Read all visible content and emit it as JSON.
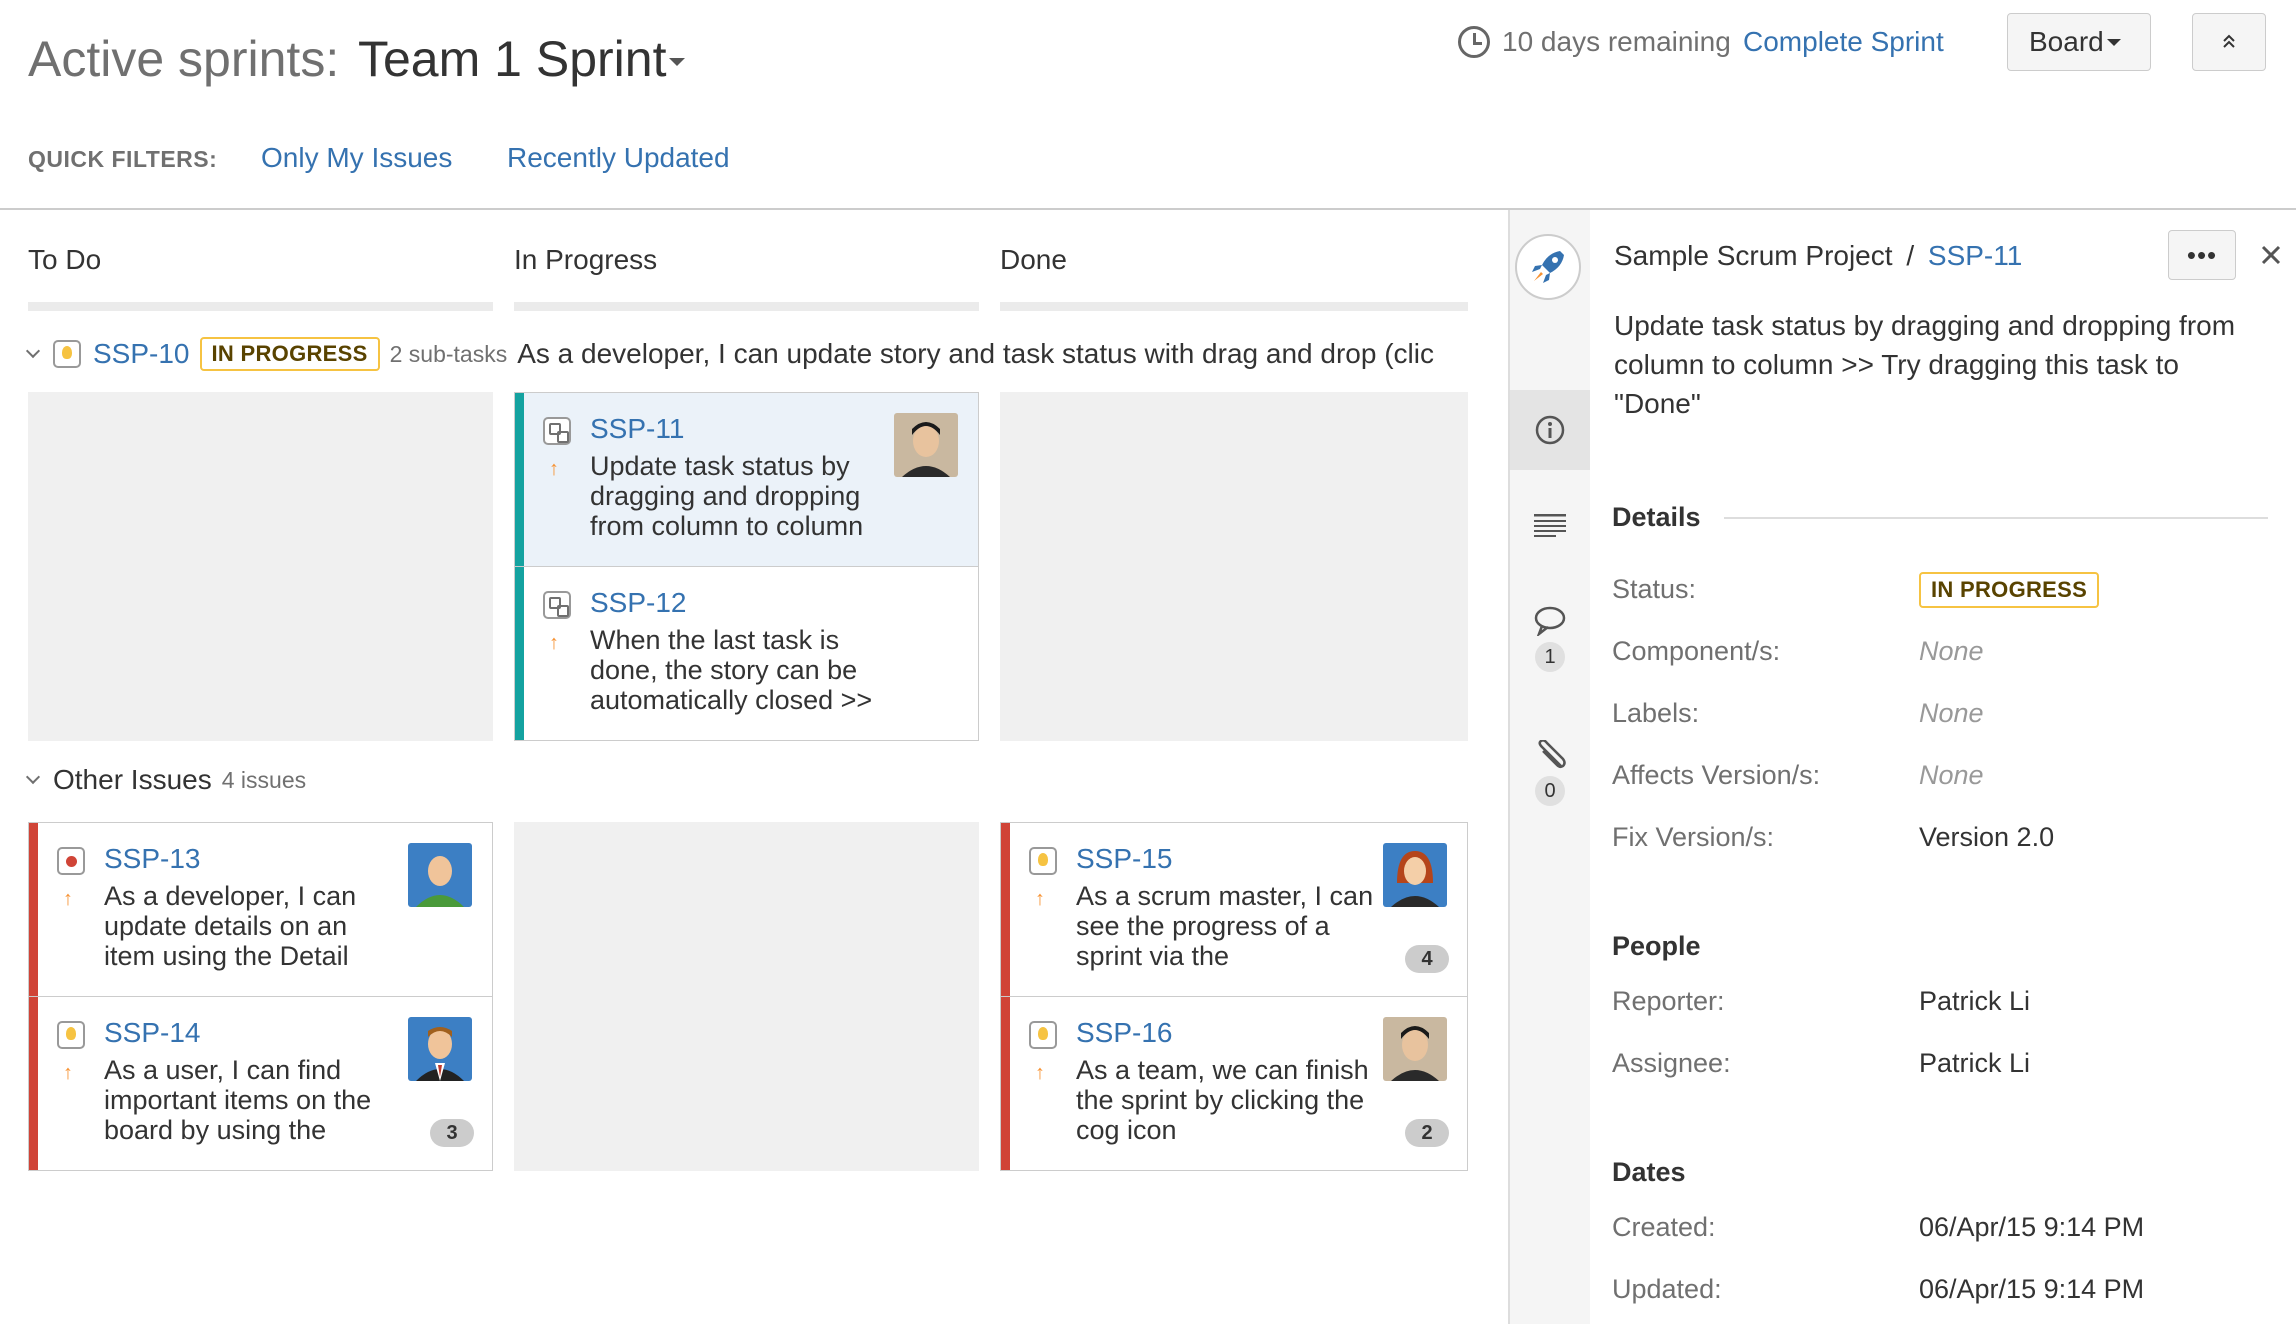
{
  "header": {
    "title": "Active sprints:",
    "sprint_name": "Team 1 Sprint",
    "days_remaining": "10 days remaining",
    "complete_sprint": "Complete Sprint",
    "board_button": "Board"
  },
  "quick_filters": {
    "label": "QUICK FILTERS:",
    "items": [
      "Only My Issues",
      "Recently Updated"
    ]
  },
  "columns": [
    "To Do",
    "In Progress",
    "Done"
  ],
  "swimlane": {
    "key": "SSP-10",
    "status": "IN PROGRESS",
    "subtasks": "2 sub-tasks",
    "summary": "As a developer, I can update story and task status with drag and drop (clic"
  },
  "cards": [
    {
      "key": "SSP-11",
      "summary": "Update task status by dragging and dropping from column to column",
      "type": "subtask-icon",
      "avatar": "avatar-asian-man"
    },
    {
      "key": "SSP-12",
      "summary": "When the last task is done, the story can be automatically closed >>",
      "type": "subtask-icon"
    },
    {
      "key": "SSP-13",
      "summary": "As a developer, I can update details on an item using the Detail",
      "type": "bug-icon",
      "avatar": "avatar-bald-man"
    },
    {
      "key": "SSP-14",
      "summary": "As a user, I can find important items on the board by using the",
      "type": "story-icon",
      "avatar": "avatar-businessman",
      "badge": "3"
    },
    {
      "key": "SSP-15",
      "summary": "As a scrum master, I can see the progress of a sprint via the",
      "type": "story-icon",
      "avatar": "avatar-redhead-woman",
      "badge": "4"
    },
    {
      "key": "SSP-16",
      "summary": "As a team, we can finish the sprint by clicking the cog icon",
      "type": "story-icon",
      "avatar": "avatar-asian-man",
      "badge": "2"
    }
  ],
  "other_issues": {
    "title": "Other Issues",
    "count": "4 issues"
  },
  "detail": {
    "project": "Sample Scrum Project",
    "separator": "/",
    "key": "SSP-11",
    "more": "•••",
    "summary": "Update task status by dragging and dropping from column to column >> Try dragging this task to \"Done\"",
    "comment_count": "1",
    "attachment_count": "0",
    "details_title": "Details",
    "fields": {
      "status_label": "Status:",
      "status_value": "IN PROGRESS",
      "components_label": "Component/s:",
      "components_value": "None",
      "labels_label": "Labels:",
      "labels_value": "None",
      "affects_label": "Affects Version/s:",
      "affects_value": "None",
      "fix_label": "Fix Version/s:",
      "fix_value": "Version 2.0"
    },
    "people_title": "People",
    "people": {
      "reporter_label": "Reporter:",
      "reporter_value": "Patrick Li",
      "assignee_label": "Assignee:",
      "assignee_value": "Patrick Li"
    },
    "dates_title": "Dates",
    "dates": {
      "created_label": "Created:",
      "created_value": "06/Apr/15 9:14 PM",
      "updated_label": "Updated:",
      "updated_value": "06/Apr/15 9:14 PM"
    }
  },
  "colors": {
    "link": "#3572b0",
    "in_progress_grabber": "#14a2a0",
    "high_priority_grabber": "#d04437",
    "lozenge_border": "#f6c342",
    "priority_arrow": "#f79232"
  }
}
